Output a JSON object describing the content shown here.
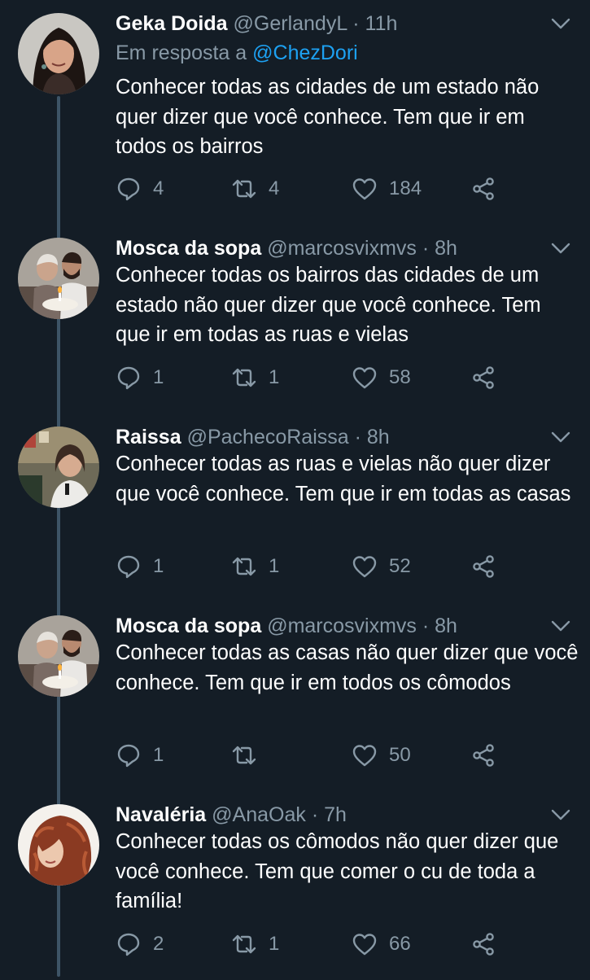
{
  "tweets": [
    {
      "name": "Geka Doida",
      "handle": "@GerlandyL",
      "time": "· 11h",
      "reply_prefix": "Em resposta a",
      "reply_mention": "@ChezDori",
      "text": "Conhecer todas as cidades de um estado não quer dizer que você conhece. Tem que ir em todos os bairros",
      "replies": "4",
      "retweets": "4",
      "likes": "184"
    },
    {
      "name": "Mosca da sopa",
      "handle": "@marcosvixmvs",
      "time": "· 8h",
      "text": "Conhecer todas os bairros das cidades de um estado não quer dizer que você conhece. Tem que ir em todas as ruas e vielas",
      "replies": "1",
      "retweets": "1",
      "likes": "58"
    },
    {
      "name": "Raissa",
      "handle": "@PachecoRaissa",
      "time": "· 8h",
      "text": "Conhecer todas as ruas e vielas não quer dizer que você conhece. Tem que ir em todas as casas",
      "replies": "1",
      "retweets": "1",
      "likes": "52"
    },
    {
      "name": "Mosca da sopa",
      "handle": "@marcosvixmvs",
      "time": "· 8h",
      "text": "Conhecer todas as casas não quer dizer que você conhece. Tem que ir em todos os cômodos",
      "replies": "1",
      "retweets": "",
      "likes": "50"
    },
    {
      "name": "Navaléria",
      "handle": "@AnaOak",
      "time": "· 7h",
      "text": "Conhecer todas os cômodos não quer dizer que você conhece. Tem que comer o cu de toda a família!",
      "replies": "2",
      "retweets": "1",
      "likes": "66"
    }
  ],
  "icons": {
    "reply": "reply-icon",
    "retweet": "retweet-icon",
    "like": "heart-icon",
    "share": "share-icon",
    "menu": "chevron-down-icon"
  },
  "colors": {
    "background": "#141d26",
    "text": "#ffffff",
    "muted": "#8899a6",
    "link": "#1da1f2",
    "thread_line": "#3d5466"
  }
}
